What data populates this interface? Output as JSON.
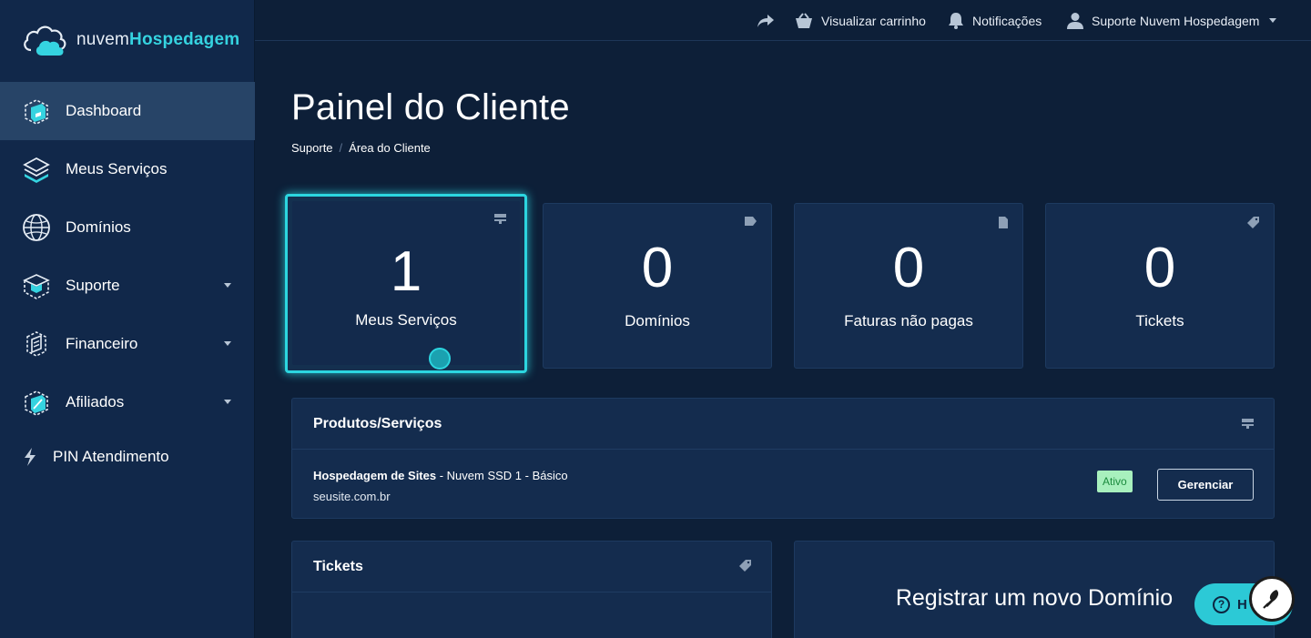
{
  "brand": {
    "light": "nuvem",
    "bold": "Hospedagem",
    "accent": "#35d3e0"
  },
  "sidebar": {
    "items": [
      {
        "label": "Dashboard",
        "icon": "dashboard-cube-icon",
        "active": true
      },
      {
        "label": "Meus Serviços",
        "icon": "layers-icon"
      },
      {
        "label": "Domínios",
        "icon": "globe-icon"
      },
      {
        "label": "Suporte",
        "icon": "support-box-icon",
        "has_submenu": true
      },
      {
        "label": "Financeiro",
        "icon": "invoice-icon",
        "has_submenu": true
      },
      {
        "label": "Afiliados",
        "icon": "affiliate-cube-icon",
        "has_submenu": true
      },
      {
        "label": "PIN Atendimento",
        "icon": "bolt-icon"
      }
    ]
  },
  "topbar": {
    "cart_label": "Visualizar carrinho",
    "notifications_label": "Notificações",
    "user_label": "Suporte Nuvem Hospedagem"
  },
  "page": {
    "title": "Painel do Cliente",
    "breadcrumb": [
      "Suporte",
      "Área do Cliente"
    ]
  },
  "stats": [
    {
      "value": "1",
      "label": "Meus Serviços",
      "icon": "server-icon"
    },
    {
      "value": "0",
      "label": "Domínios",
      "icon": "tag-icon"
    },
    {
      "value": "0",
      "label": "Faturas não pagas",
      "icon": "file-icon"
    },
    {
      "value": "0",
      "label": "Tickets",
      "icon": "ticket-tag-icon"
    }
  ],
  "products": {
    "title": "Produtos/Serviços",
    "service": {
      "name": "Hospedagem de Sites",
      "plan": " - Nuvem SSD 1 - Básico",
      "domain": "seusite.com.br",
      "status": "Ativo",
      "action": "Gerenciar"
    }
  },
  "tickets_panel": {
    "title": "Tickets"
  },
  "domain_panel": {
    "title": "Registrar um novo Domínio"
  },
  "help": {
    "label": "H"
  },
  "colors": {
    "background": "#0d1f38",
    "sidebar": "#11284a",
    "card": "#142c4e",
    "accent": "#2cd6e0",
    "status_active_bg": "#a8f0bd",
    "status_active_text": "#1b8a3d"
  }
}
